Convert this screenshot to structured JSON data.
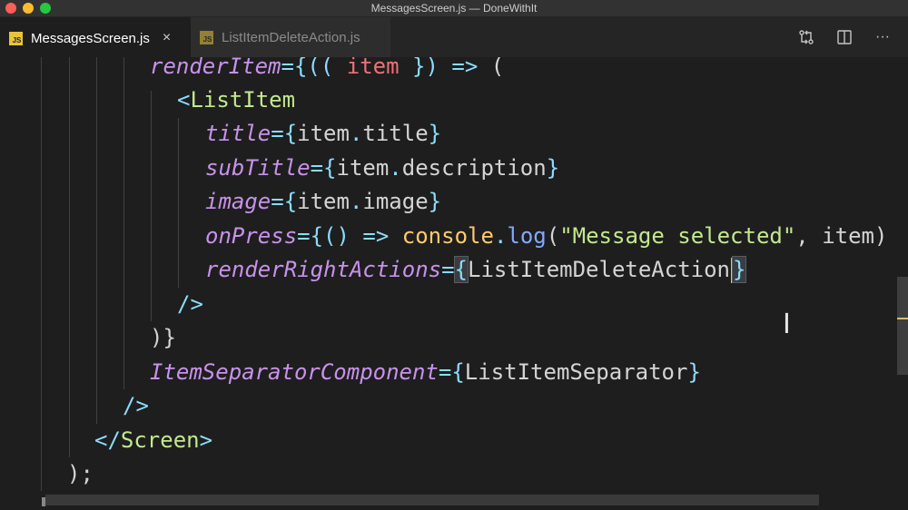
{
  "window": {
    "title": "MessagesScreen.js — DoneWithIt"
  },
  "tabs": [
    {
      "badge": "JS",
      "label": "MessagesScreen.js",
      "close": "×"
    },
    {
      "badge": "JS",
      "label": "ListItemDeleteAction.js"
    }
  ],
  "toolbar": {
    "icons": [
      "git-compare-icon",
      "split-editor-icon",
      "more-actions-icon"
    ],
    "more_label": "···"
  },
  "code": {
    "l1": {
      "a": "renderItem",
      "b": "=",
      "c": "{((",
      "d": " ",
      "e": "item",
      "f": " ",
      "g": "})",
      "h": " ",
      "i": "=>",
      "j": " ",
      "k": "("
    },
    "l2": {
      "a": "<",
      "b": "ListItem"
    },
    "l3": {
      "a": "title",
      "b": "=",
      "c": "{",
      "d": "item",
      "e": ".",
      "f": "title",
      "g": "}"
    },
    "l4": {
      "a": "subTitle",
      "b": "=",
      "c": "{",
      "d": "item",
      "e": ".",
      "f": "description",
      "g": "}"
    },
    "l5": {
      "a": "image",
      "b": "=",
      "c": "{",
      "d": "item",
      "e": ".",
      "f": "image",
      "g": "}"
    },
    "l6": {
      "a": "onPress",
      "b": "=",
      "c": "{()",
      "d": " ",
      "e": "=>",
      "f": " ",
      "g": "console",
      "h": ".",
      "i": "log",
      "j": "(",
      "k": "\"Message selected\"",
      "l": ", ",
      "m": "item)"
    },
    "l7": {
      "a": "renderRightActions",
      "b": "=",
      "c": "{",
      "d": "ListItemDeleteAction",
      "e": "}"
    },
    "l8": {
      "a": "/>"
    },
    "l9": {
      "a": ")}"
    },
    "l10": {
      "a": "ItemSeparatorComponent",
      "b": "=",
      "c": "{",
      "d": "ListItemSeparator",
      "e": "}"
    },
    "l11": {
      "a": "/>"
    },
    "l12": {
      "a": "</",
      "b": "Screen",
      "c": ">"
    },
    "l13": {
      "a": ");"
    }
  }
}
